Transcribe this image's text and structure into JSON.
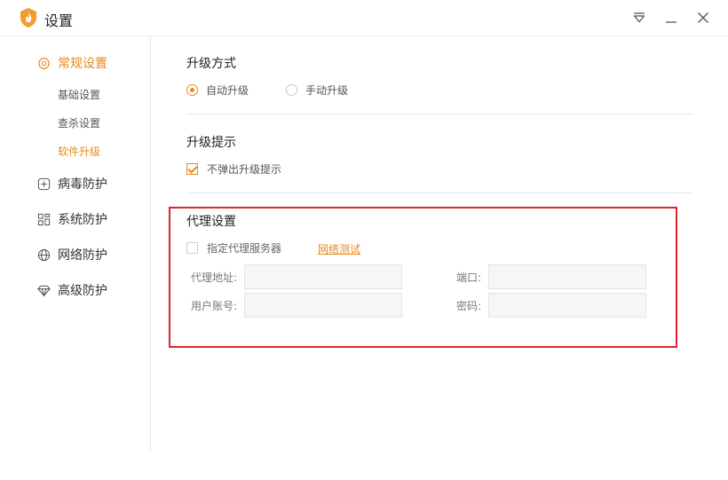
{
  "window": {
    "title": "设置",
    "accent_color": "#e58a1f"
  },
  "sidebar": {
    "groups": [
      {
        "label": "常规设置",
        "icon": "gear-icon",
        "active": true,
        "items": [
          {
            "label": "基础设置",
            "active": false
          },
          {
            "label": "查杀设置",
            "active": false
          },
          {
            "label": "软件升级",
            "active": true
          }
        ]
      },
      {
        "label": "病毒防护",
        "icon": "plus-square-icon"
      },
      {
        "label": "系统防护",
        "icon": "grid-icon"
      },
      {
        "label": "网络防护",
        "icon": "globe-icon"
      },
      {
        "label": "高级防护",
        "icon": "diamond-icon"
      }
    ]
  },
  "upgrade_mode": {
    "title": "升级方式",
    "options": [
      {
        "label": "自动升级",
        "selected": true
      },
      {
        "label": "手动升级",
        "selected": false
      }
    ]
  },
  "upgrade_notice": {
    "title": "升级提示",
    "checkbox_label": "不弹出升级提示",
    "checked": true
  },
  "proxy": {
    "title": "代理设置",
    "checkbox_label": "指定代理服务器",
    "checked": false,
    "test_link": "网络测试",
    "address_label": "代理地址:",
    "address_value": "",
    "port_label": "端口:",
    "port_value": "",
    "user_label": "用户账号:",
    "user_value": "",
    "password_label": "密码:",
    "password_value": ""
  }
}
